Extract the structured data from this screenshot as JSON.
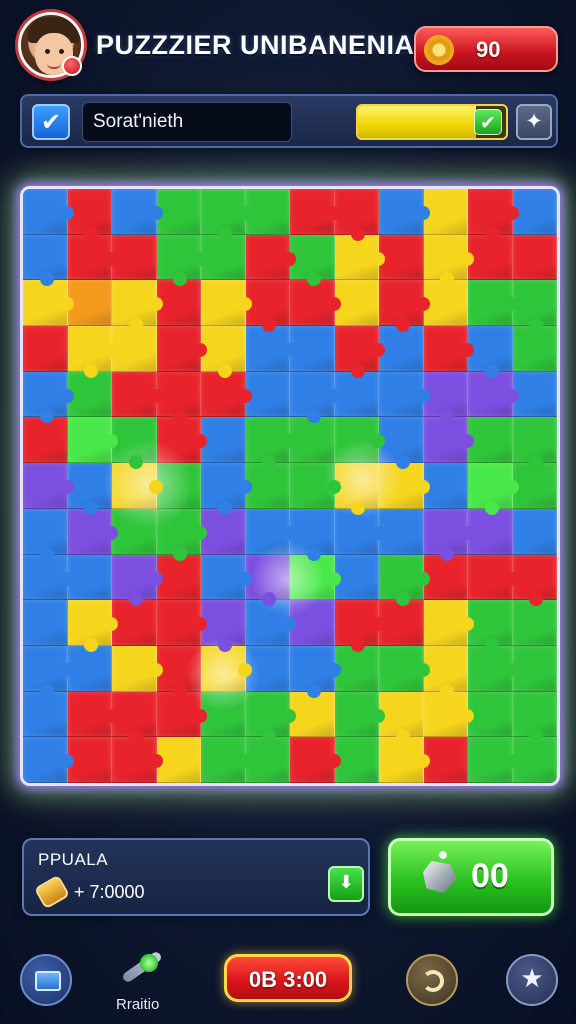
{
  "header": {
    "title": "PUZZZIER UNIBANENIA",
    "coins": "90",
    "avatar_icon": "player-avatar",
    "coin_icon": "gear-coin-icon"
  },
  "toolbar": {
    "check_glyph": "✔",
    "name_value": "Sorat'nieth",
    "progress_fraction": 0.8,
    "confirm_glyph": "✔",
    "puzzle_glyph": "✦"
  },
  "board": {
    "columns": 12,
    "rows": 13,
    "colors": {
      "R": "#e8232b",
      "G": "#2fc53a",
      "B": "#2f7fe6",
      "Y": "#f6d51d",
      "O": "#f39a1c",
      "P": "#7b4fe0",
      "L": "#49e84a"
    },
    "layout": [
      "BRBGGGRRBYRB",
      "BRRGGRGYRYRR",
      "YOYRYRRYRYGG",
      "RYYRYBBRBRBG",
      "BGRRRBBBBPPB",
      "RLGRBGGGBPGG",
      "PBYGBGGYYBLG",
      "BPGGPBBBBPPB",
      "BBPRBPLBGRRR",
      "BYRRPBPRRYGG",
      "BBYRYBBGGYGG",
      "BRRRGGYGYYGG",
      "BRRYGGRGYRGG"
    ]
  },
  "stats": {
    "label": "PPUALA",
    "value": "+ 7:0000",
    "down_glyph": "⬇"
  },
  "gem_button": {
    "value": "00"
  },
  "nav": {
    "hint_label": "Rraitio",
    "timer": "0B 3:00",
    "star_glyph": "★"
  }
}
